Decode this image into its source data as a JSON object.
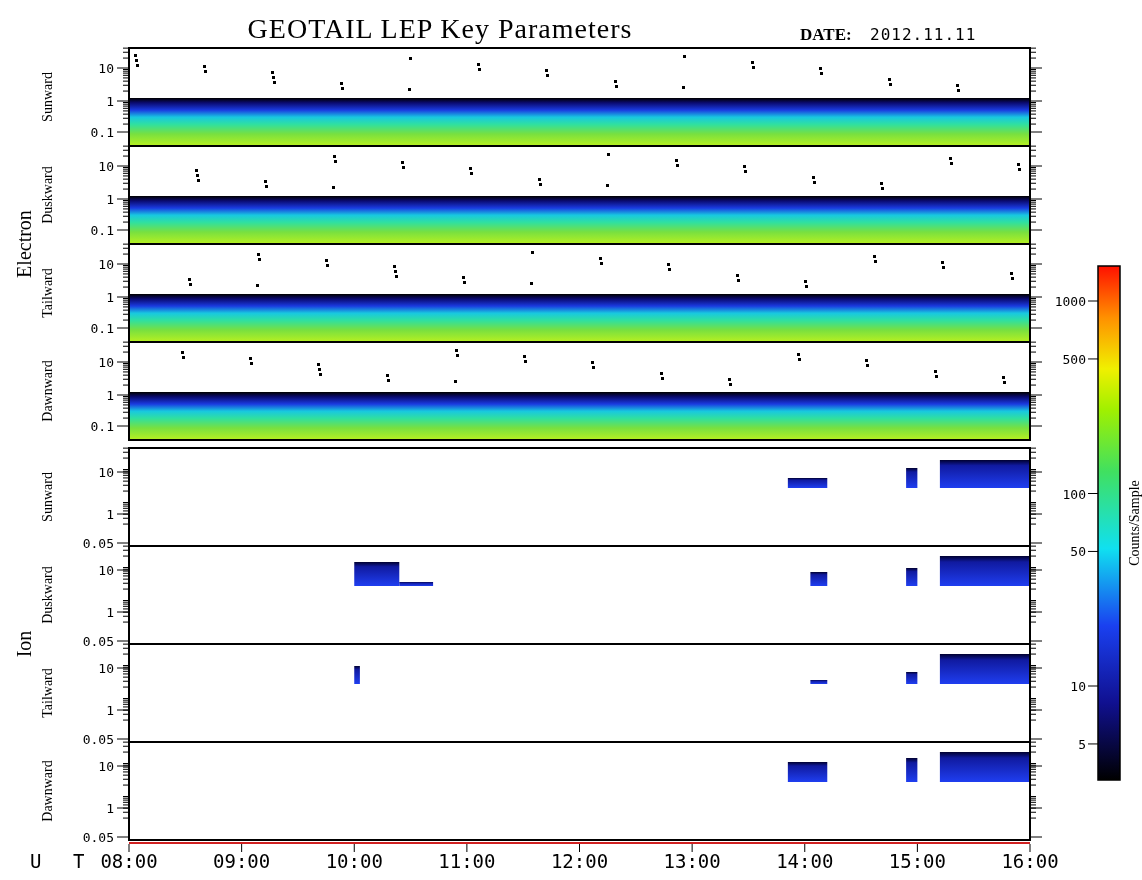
{
  "title": "GEOTAIL LEP Key Parameters",
  "date": {
    "label": "DATE:",
    "value": "2012.11.11"
  },
  "groups": [
    {
      "kind": "electron",
      "label": "Electron",
      "panels": [
        {
          "label": "Sunward",
          "yticks": [
            "10",
            "1",
            "0.1"
          ]
        },
        {
          "label": "Duskward",
          "yticks": [
            "10",
            "1",
            "0.1"
          ]
        },
        {
          "label": "Tailward",
          "yticks": [
            "10",
            "1",
            "0.1"
          ]
        },
        {
          "label": "Dawnward",
          "yticks": [
            "10",
            "1",
            "0.1"
          ]
        }
      ]
    },
    {
      "kind": "ion",
      "label": "Ion",
      "panels": [
        {
          "label": "Sunward",
          "yticks": [
            "10",
            "1",
            "0.05"
          ]
        },
        {
          "label": "Duskward",
          "yticks": [
            "10",
            "1",
            "0.05"
          ]
        },
        {
          "label": "Tailward",
          "yticks": [
            "10",
            "1",
            "0.05"
          ]
        },
        {
          "label": "Dawnward",
          "yticks": [
            "10",
            "1",
            "0.05"
          ]
        }
      ]
    }
  ],
  "x_axis": {
    "label": "U T",
    "ticks": [
      "08:00",
      "09:00",
      "10:00",
      "11:00",
      "12:00",
      "13:00",
      "14:00",
      "15:00",
      "16:00"
    ]
  },
  "colorbar": {
    "label": "Counts/Sample",
    "ticks": [
      "1000",
      "500",
      "100",
      "50",
      "10",
      "5"
    ]
  }
}
